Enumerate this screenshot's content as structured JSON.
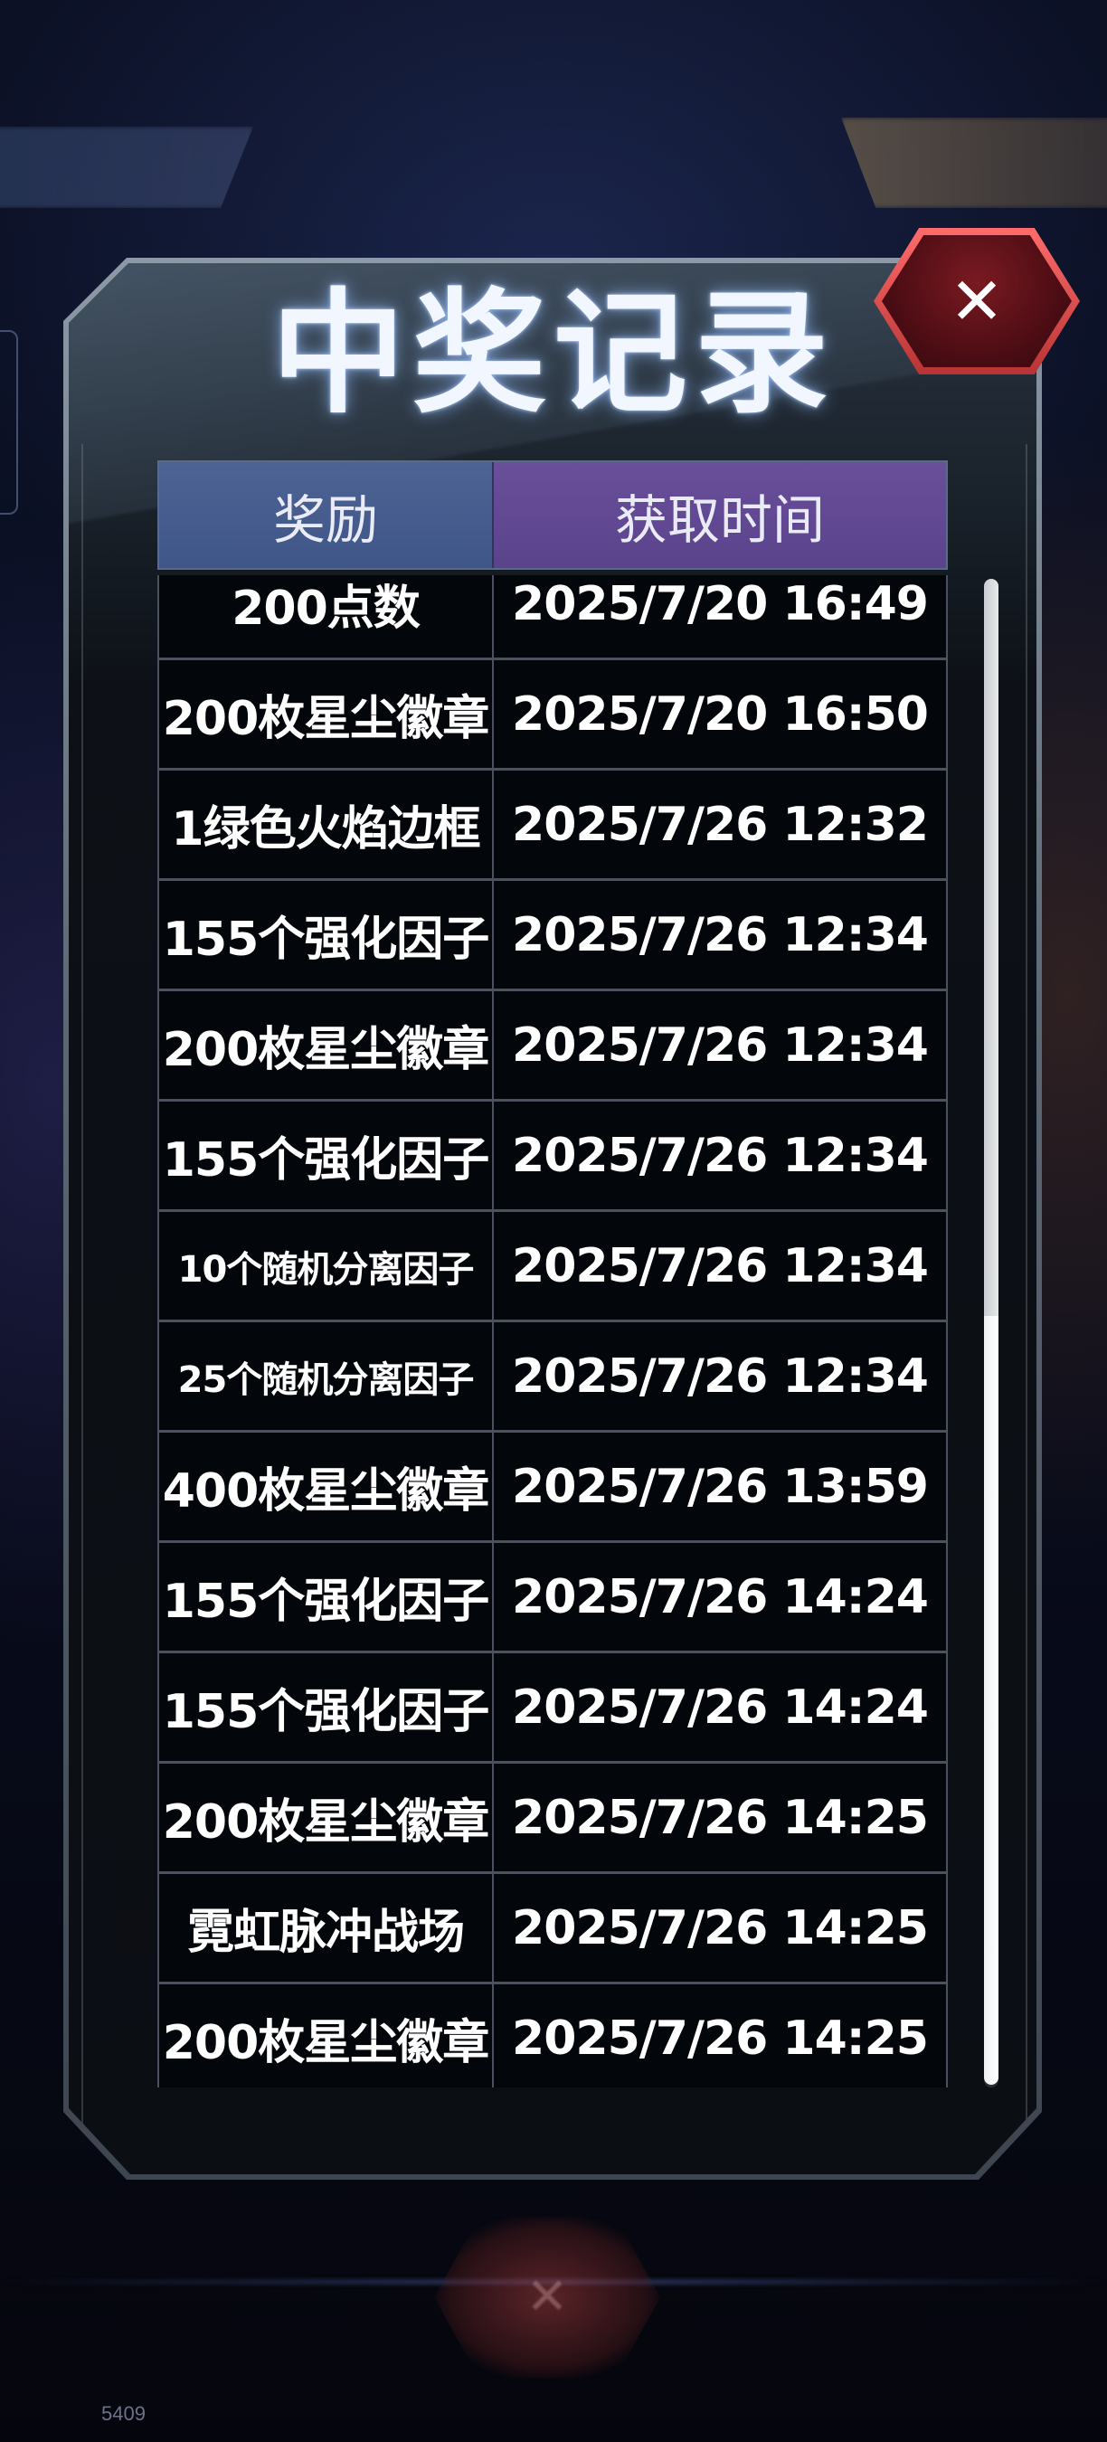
{
  "dialog": {
    "title": "中奖记录",
    "close_icon": "close-icon"
  },
  "table": {
    "headers": {
      "reward": "奖励",
      "time": "获取时间"
    },
    "rows": [
      {
        "reward": "200点数",
        "time": "2025/7/20 16:49"
      },
      {
        "reward": "200枚星尘徽章",
        "time": "2025/7/20 16:50"
      },
      {
        "reward": "1绿色火焰边框",
        "time": "2025/7/26 12:32"
      },
      {
        "reward": "155个强化因子",
        "time": "2025/7/26 12:34"
      },
      {
        "reward": "200枚星尘徽章",
        "time": "2025/7/26 12:34"
      },
      {
        "reward": "155个强化因子",
        "time": "2025/7/26 12:34"
      },
      {
        "reward": "10个随机分离因子",
        "time": "2025/7/26 12:34"
      },
      {
        "reward": "25个随机分离因子",
        "time": "2025/7/26 12:34"
      },
      {
        "reward": "400枚星尘徽章",
        "time": "2025/7/26 13:59"
      },
      {
        "reward": "155个强化因子",
        "time": "2025/7/26 14:24"
      },
      {
        "reward": "155个强化因子",
        "time": "2025/7/26 14:24"
      },
      {
        "reward": "200枚星尘徽章",
        "time": "2025/7/26 14:25"
      },
      {
        "reward": "霓虹脉冲战场",
        "time": "2025/7/26 14:25"
      },
      {
        "reward": "200枚星尘徽章",
        "time": "2025/7/26 14:25"
      }
    ]
  },
  "footer": {
    "build_id": "5409"
  },
  "colors": {
    "reward_header": "#4d6394",
    "time_header": "#6a4f9a",
    "close_button": "#b83434",
    "title_glow": "#96beff"
  }
}
